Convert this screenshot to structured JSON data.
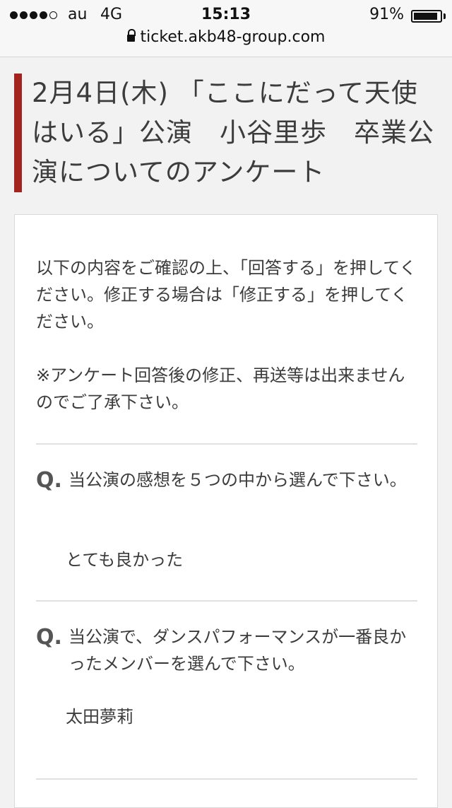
{
  "status_bar": {
    "carrier": "au",
    "network": "4G",
    "time": "15:13",
    "battery_percent": "91%",
    "battery_level": 0.91,
    "url": "ticket.akb48-group.com"
  },
  "page": {
    "title": "2月4日(木) 「ここにだって天使はいる」公演　小谷里歩　卒業公演についてのアンケート",
    "accent_color": "#a3231f"
  },
  "intro": {
    "line1": "以下の内容をご確認の上、「回答する」を押してください。修正する場合は「修正する」を押してください。",
    "line2": "※アンケート回答後の修正、再送等は出来ませんのでご了承下さい。"
  },
  "questions": [
    {
      "mark": "Q.",
      "question": "当公演の感想を５つの中から選んで下さい。",
      "answer": "とても良かった"
    },
    {
      "mark": "Q.",
      "question": "当公演で、ダンスパフォーマンスが一番良かったメンバーを選んで下さい。",
      "answer": "太田夢莉"
    }
  ]
}
